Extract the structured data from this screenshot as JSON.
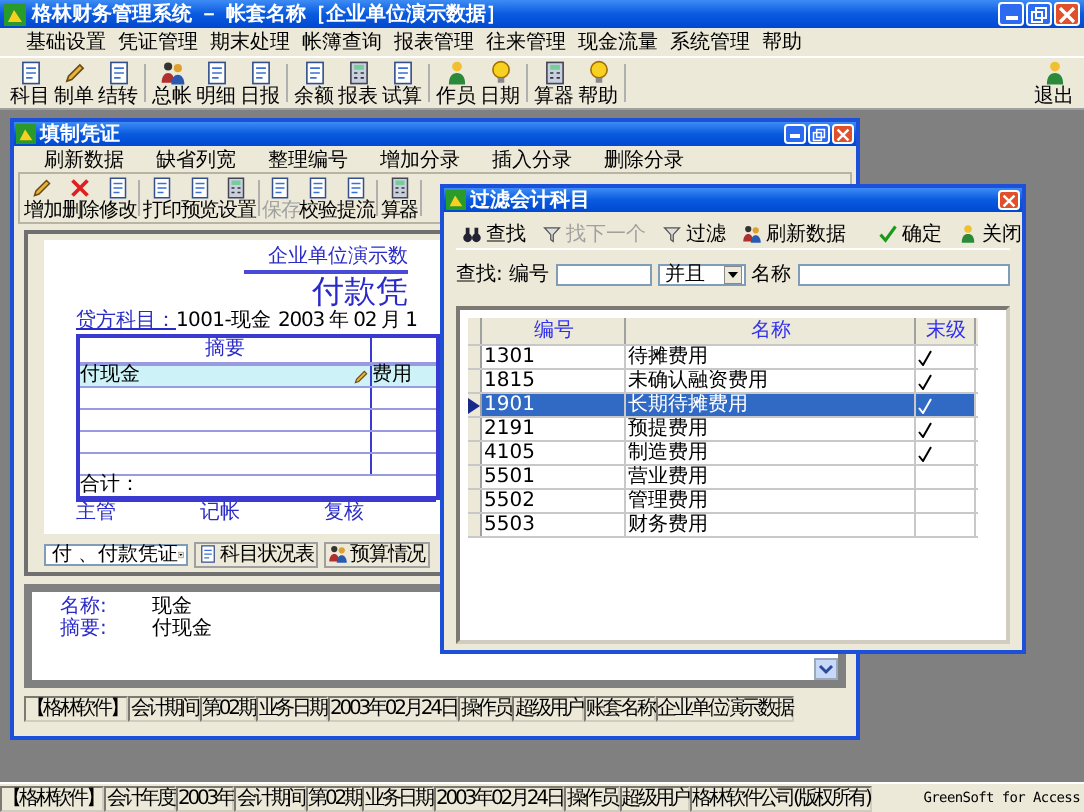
{
  "app": {
    "title": "格林财务管理系统 － 帐套名称［企业单位演示数据］",
    "menu": [
      "基础设置",
      "凭证管理",
      "期末处理",
      "帐簿查询",
      "报表管理",
      "往来管理",
      "现金流量",
      "系统管理",
      "帮助"
    ],
    "toolbar": [
      {
        "items": [
          {
            "label": "科目"
          },
          {
            "label": "制单"
          },
          {
            "label": "结转"
          }
        ]
      },
      {
        "items": [
          {
            "label": "总帐"
          },
          {
            "label": "明细"
          },
          {
            "label": "日报"
          }
        ]
      },
      {
        "items": [
          {
            "label": "余额"
          },
          {
            "label": "报表"
          },
          {
            "label": "试算"
          }
        ]
      },
      {
        "items": [
          {
            "label": "作员"
          },
          {
            "label": "日期"
          }
        ]
      },
      {
        "items": [
          {
            "label": "算器"
          },
          {
            "label": "帮助"
          }
        ]
      }
    ],
    "exit": {
      "label": "退出"
    }
  },
  "voucher_window": {
    "title": "填制凭证",
    "menu": [
      "刷新数据",
      "缺省列宽",
      "整理编号",
      "增加分录",
      "插入分录",
      "删除分录"
    ],
    "toolbar": [
      {
        "items": [
          {
            "label": "增加",
            "disabled": false
          },
          {
            "label": "删除",
            "disabled": false
          },
          {
            "label": "修改",
            "disabled": false
          }
        ]
      },
      {
        "items": [
          {
            "label": "打印",
            "disabled": false
          },
          {
            "label": "预览",
            "disabled": false
          },
          {
            "label": "设置",
            "disabled": false
          }
        ]
      },
      {
        "items": [
          {
            "label": "保存",
            "disabled": true
          },
          {
            "label": "校验",
            "disabled": false
          },
          {
            "label": "提流",
            "disabled": false
          }
        ]
      },
      {
        "items": [
          {
            "label": "算器",
            "disabled": false
          }
        ]
      }
    ],
    "paper": {
      "company": "企业单位演示数",
      "title": "付款凭",
      "credit_label": "贷方科目：",
      "credit_value": "1001-现金",
      "date": "2003 年 02 月 1",
      "header": "摘要",
      "lines": [
        {
          "summary": "付现金",
          "account": "费用",
          "selected": true
        }
      ],
      "total_label": "合计：",
      "signatures": [
        "主管",
        "记帐",
        "复核"
      ]
    },
    "voucher_type": "付 、付款凭证",
    "buttons": [
      "科目状况表",
      "预算情况"
    ],
    "details": [
      {
        "label": "名称:",
        "value": "现金"
      },
      {
        "label": "摘要:",
        "value": "付现金"
      }
    ],
    "status_bar": [
      "【格林软件】",
      "会计期间",
      "第02期",
      "业务日期",
      "2003年02月24日",
      "操作员",
      "超级用户",
      "账套名称",
      "企业单位演示数据"
    ]
  },
  "filter_dialog": {
    "title": "过滤会计科目",
    "toolbar": [
      {
        "label": "查找",
        "disabled": false
      },
      {
        "label": "找下一个",
        "disabled": true
      },
      {
        "label": "过滤",
        "disabled": false
      },
      {
        "label": "刷新数据",
        "disabled": false
      }
    ],
    "actions": [
      "确定",
      "关闭"
    ],
    "find": {
      "label": "查找: 编号",
      "operator": "并且",
      "name_label": "名称"
    },
    "columns": [
      "编号",
      "名称",
      "末级"
    ],
    "rows": [
      {
        "code": "1301",
        "name": "待摊费用",
        "leaf": true,
        "selected": false
      },
      {
        "code": "1815",
        "name": "未确认融资费用",
        "leaf": true,
        "selected": false
      },
      {
        "code": "1901",
        "name": "长期待摊费用",
        "leaf": true,
        "selected": true
      },
      {
        "code": "2191",
        "name": "预提费用",
        "leaf": true,
        "selected": false
      },
      {
        "code": "4105",
        "name": "制造费用",
        "leaf": true,
        "selected": false
      },
      {
        "code": "5501",
        "name": "营业费用",
        "leaf": false,
        "selected": false
      },
      {
        "code": "5502",
        "name": "管理费用",
        "leaf": false,
        "selected": false
      },
      {
        "code": "5503",
        "name": "财务费用",
        "leaf": false,
        "selected": false
      }
    ]
  },
  "status_bar": {
    "items": [
      "【格林软件】",
      "会计年度",
      "2003年",
      "会计期间",
      "第02期",
      "业务日期",
      "2003年02月24日",
      "操作员",
      "超级用户",
      "格林软件公司(版权所有)"
    ],
    "product": "GreenSoft for Access"
  }
}
